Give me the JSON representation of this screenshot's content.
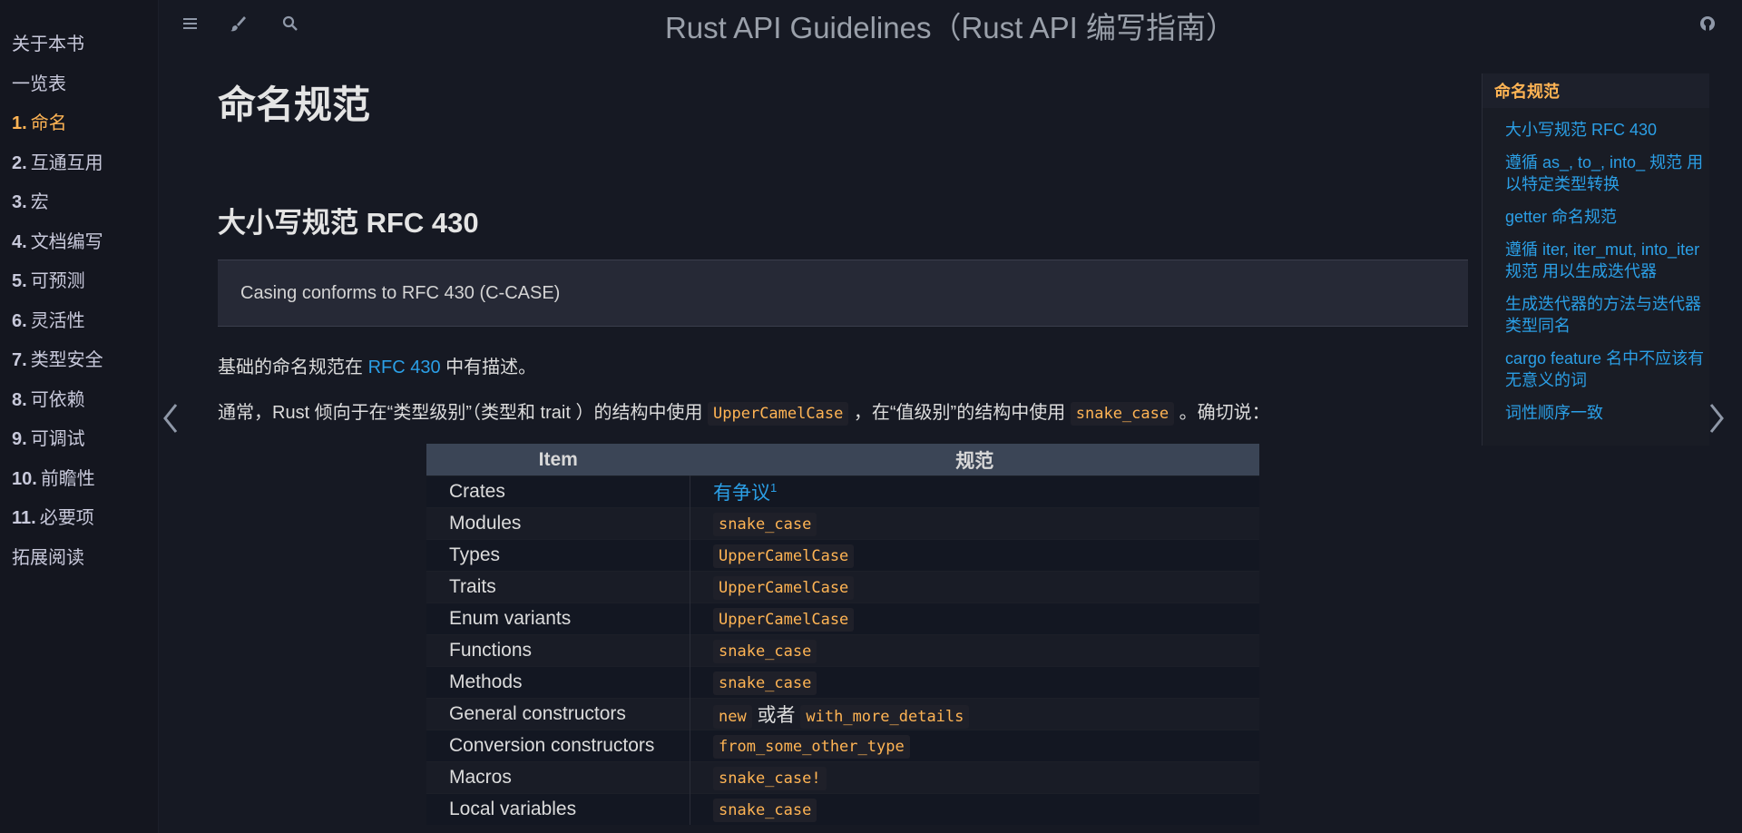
{
  "book_title": "Rust API Guidelines（Rust API 编写指南）",
  "sidebar": {
    "items": [
      {
        "num": "",
        "label": "关于本书",
        "active": false
      },
      {
        "num": "",
        "label": "一览表",
        "active": false
      },
      {
        "num": "1.",
        "label": "命名",
        "active": true
      },
      {
        "num": "2.",
        "label": "互通互用",
        "active": false
      },
      {
        "num": "3.",
        "label": "宏",
        "active": false
      },
      {
        "num": "4.",
        "label": "文档编写",
        "active": false
      },
      {
        "num": "5.",
        "label": "可预测",
        "active": false
      },
      {
        "num": "6.",
        "label": "灵活性",
        "active": false
      },
      {
        "num": "7.",
        "label": "类型安全",
        "active": false
      },
      {
        "num": "8.",
        "label": "可依赖",
        "active": false
      },
      {
        "num": "9.",
        "label": "可调试",
        "active": false
      },
      {
        "num": "10.",
        "label": "前瞻性",
        "active": false
      },
      {
        "num": "11.",
        "label": "必要项",
        "active": false
      },
      {
        "num": "",
        "label": "拓展阅读",
        "active": false
      }
    ]
  },
  "toolbar": {
    "menu_icon": "hamburger-icon",
    "theme_icon": "paintbrush-icon",
    "search_icon": "search-icon",
    "repo_icon": "github-icon"
  },
  "content": {
    "h1": "命名规范",
    "h2": "大小写规范 RFC 430",
    "blockquote": "Casing conforms to RFC 430 (C-CASE)",
    "p1": {
      "before": "基础的命名规范在 ",
      "link": "RFC 430",
      "after": " 中有描述。"
    },
    "p2": {
      "t1": "通常，Rust 倾向于在“类型级别”（类型和 trait ）的结构中使用 ",
      "c1": "UpperCamelCase",
      "t2": " ，在“值级别”的结构中使用 ",
      "c2": "snake_case",
      "t3": " 。确切说："
    }
  },
  "table": {
    "headers": [
      "Item",
      "规范"
    ],
    "rows": [
      {
        "item": "Crates",
        "rule": [
          {
            "link": "有争议"
          },
          {
            "sup": "1"
          }
        ]
      },
      {
        "item": "Modules",
        "rule": [
          {
            "code": "snake_case"
          }
        ]
      },
      {
        "item": "Types",
        "rule": [
          {
            "code": "UpperCamelCase"
          }
        ]
      },
      {
        "item": "Traits",
        "rule": [
          {
            "code": "UpperCamelCase"
          }
        ]
      },
      {
        "item": "Enum variants",
        "rule": [
          {
            "code": "UpperCamelCase"
          }
        ]
      },
      {
        "item": "Functions",
        "rule": [
          {
            "code": "snake_case"
          }
        ]
      },
      {
        "item": "Methods",
        "rule": [
          {
            "code": "snake_case"
          }
        ]
      },
      {
        "item": "General constructors",
        "rule": [
          {
            "code": "new"
          },
          {
            "text": " 或者 "
          },
          {
            "code": "with_more_details"
          }
        ]
      },
      {
        "item": "Conversion constructors",
        "rule": [
          {
            "code": "from_some_other_type"
          }
        ]
      },
      {
        "item": "Macros",
        "rule": [
          {
            "code": "snake_case!"
          }
        ]
      },
      {
        "item": "Local variables",
        "rule": [
          {
            "code": "snake_case"
          }
        ]
      }
    ]
  },
  "toc": {
    "title": "命名规范",
    "items": [
      "大小写规范 RFC 430",
      "遵循 as_, to_, into_ 规范 用以特定类型转换",
      "getter 命名规范",
      "遵循 iter, iter_mut, into_iter 规范 用以生成迭代器",
      "生成迭代器的方法与迭代器类型同名",
      "cargo feature 名中不应该有无意义的词",
      "词性顺序一致"
    ]
  },
  "nav": {
    "prev_icon": "chevron-left-icon",
    "next_icon": "chevron-right-icon"
  },
  "colors": {
    "accent": "#ffb454",
    "link": "#2b9fe6",
    "background": "#161923",
    "sidebar": "#14161f"
  }
}
